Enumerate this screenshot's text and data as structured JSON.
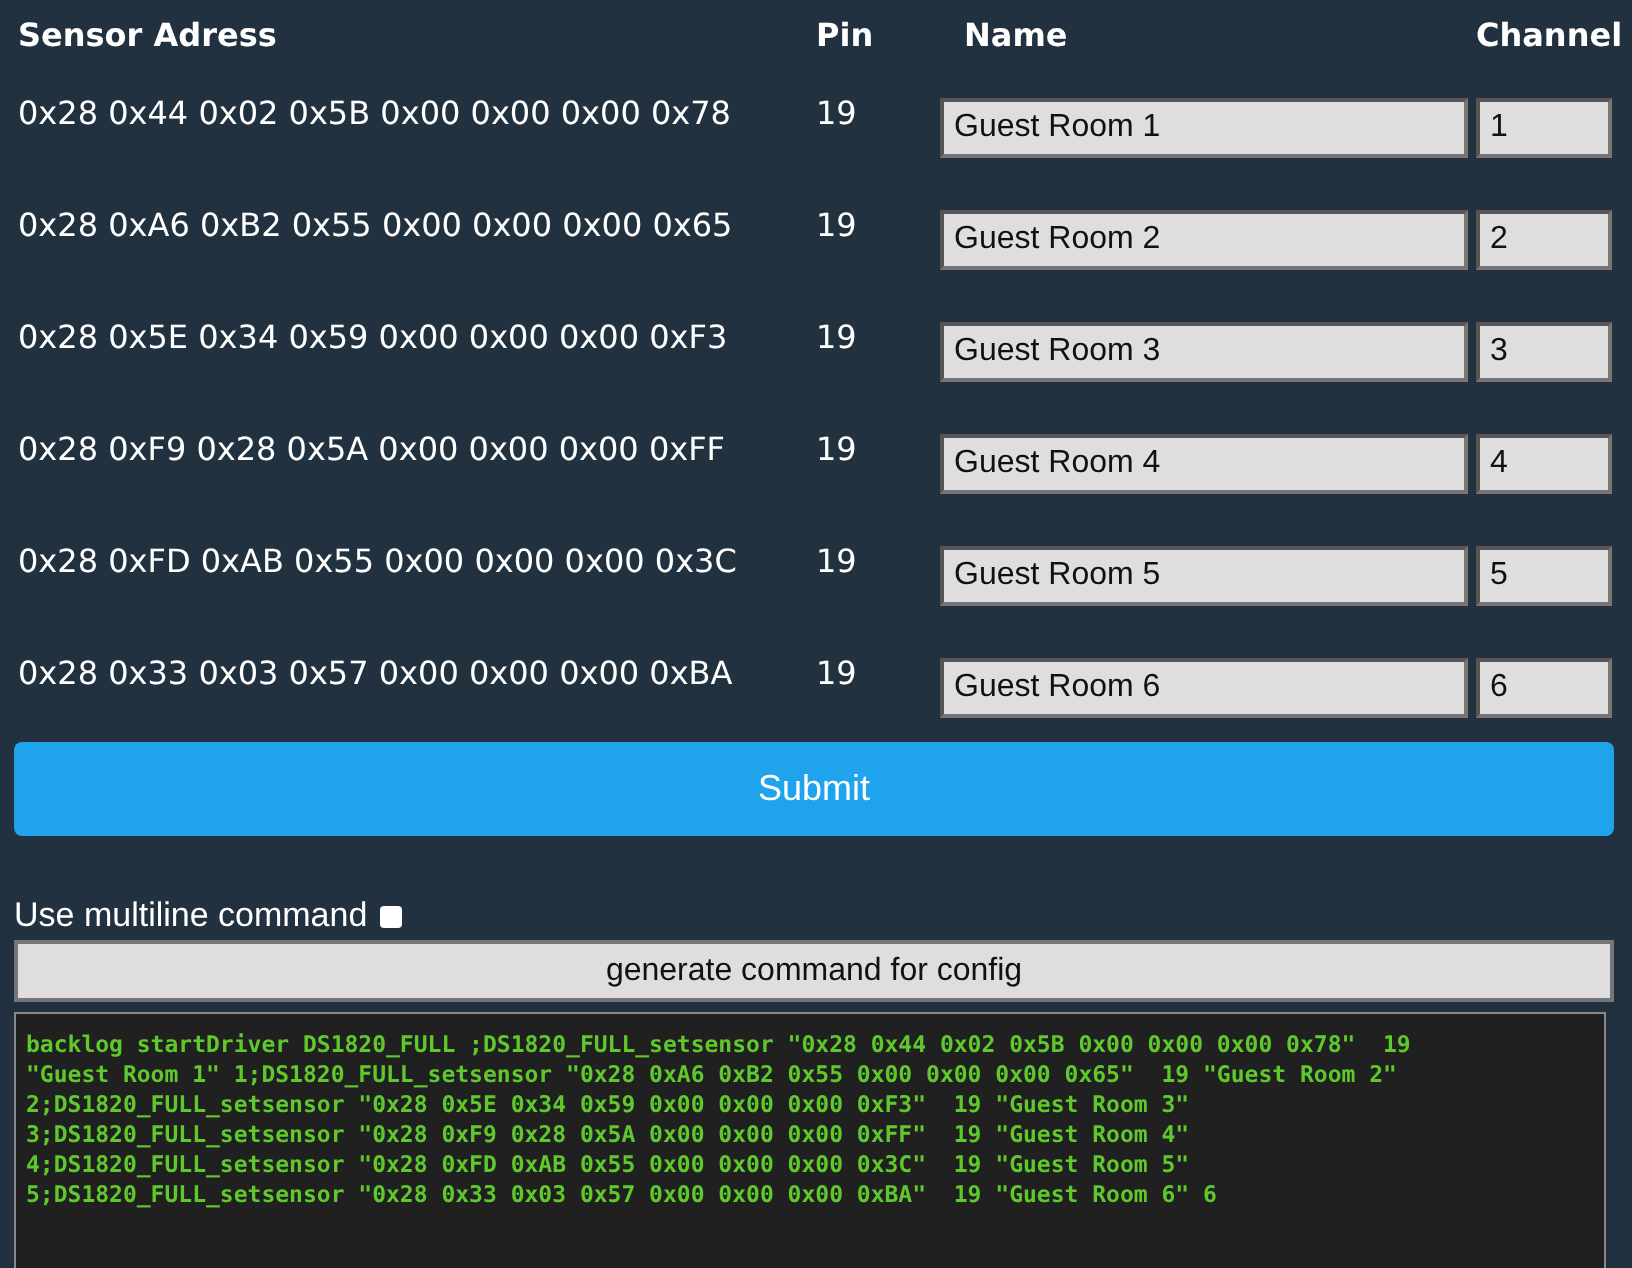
{
  "table": {
    "columns": [
      "Sensor Adress",
      "Pin",
      "Name",
      "Channel"
    ],
    "rows": [
      {
        "address": "0x28 0x44 0x02 0x5B 0x00 0x00 0x00 0x78",
        "pin": "19",
        "name": "Guest Room 1",
        "channel": "1"
      },
      {
        "address": "0x28 0xA6 0xB2 0x55 0x00 0x00 0x00 0x65",
        "pin": "19",
        "name": "Guest Room 2",
        "channel": "2"
      },
      {
        "address": "0x28 0x5E 0x34 0x59 0x00 0x00 0x00 0xF3",
        "pin": "19",
        "name": "Guest Room 3",
        "channel": "3"
      },
      {
        "address": "0x28 0xF9 0x28 0x5A 0x00 0x00 0x00 0xFF",
        "pin": "19",
        "name": "Guest Room 4",
        "channel": "4"
      },
      {
        "address": "0x28 0xFD 0xAB 0x55 0x00 0x00 0x00 0x3C",
        "pin": "19",
        "name": "Guest Room 5",
        "channel": "5"
      },
      {
        "address": "0x28 0x33 0x03 0x57 0x00 0x00 0x00 0xBA",
        "pin": "19",
        "name": "Guest Room 6",
        "channel": "6"
      }
    ]
  },
  "submit_button": "Submit",
  "multiline": {
    "label": "Use multiline command",
    "checked": false
  },
  "generate_button": "generate command for config",
  "output_lines": [
    "backlog startDriver DS1820_FULL ;DS1820_FULL_setsensor \"0x28 0x44 0x02 0x5B 0x00 0x00 0x00 0x78\"  19",
    "\"Guest Room 1\" 1;DS1820_FULL_setsensor \"0x28 0xA6 0xB2 0x55 0x00 0x00 0x00 0x65\"  19 \"Guest Room 2\"",
    "2;DS1820_FULL_setsensor \"0x28 0x5E 0x34 0x59 0x00 0x00 0x00 0xF3\"  19 \"Guest Room 3\"",
    "3;DS1820_FULL_setsensor \"0x28 0xF9 0x28 0x5A 0x00 0x00 0x00 0xFF\"  19 \"Guest Room 4\"",
    "4;DS1820_FULL_setsensor \"0x28 0xFD 0xAB 0x55 0x00 0x00 0x00 0x3C\"  19 \"Guest Room 5\"",
    "5;DS1820_FULL_setsensor \"0x28 0x33 0x03 0x57 0x00 0x00 0x00 0xBA\"  19 \"Guest Room 6\" 6"
  ]
}
